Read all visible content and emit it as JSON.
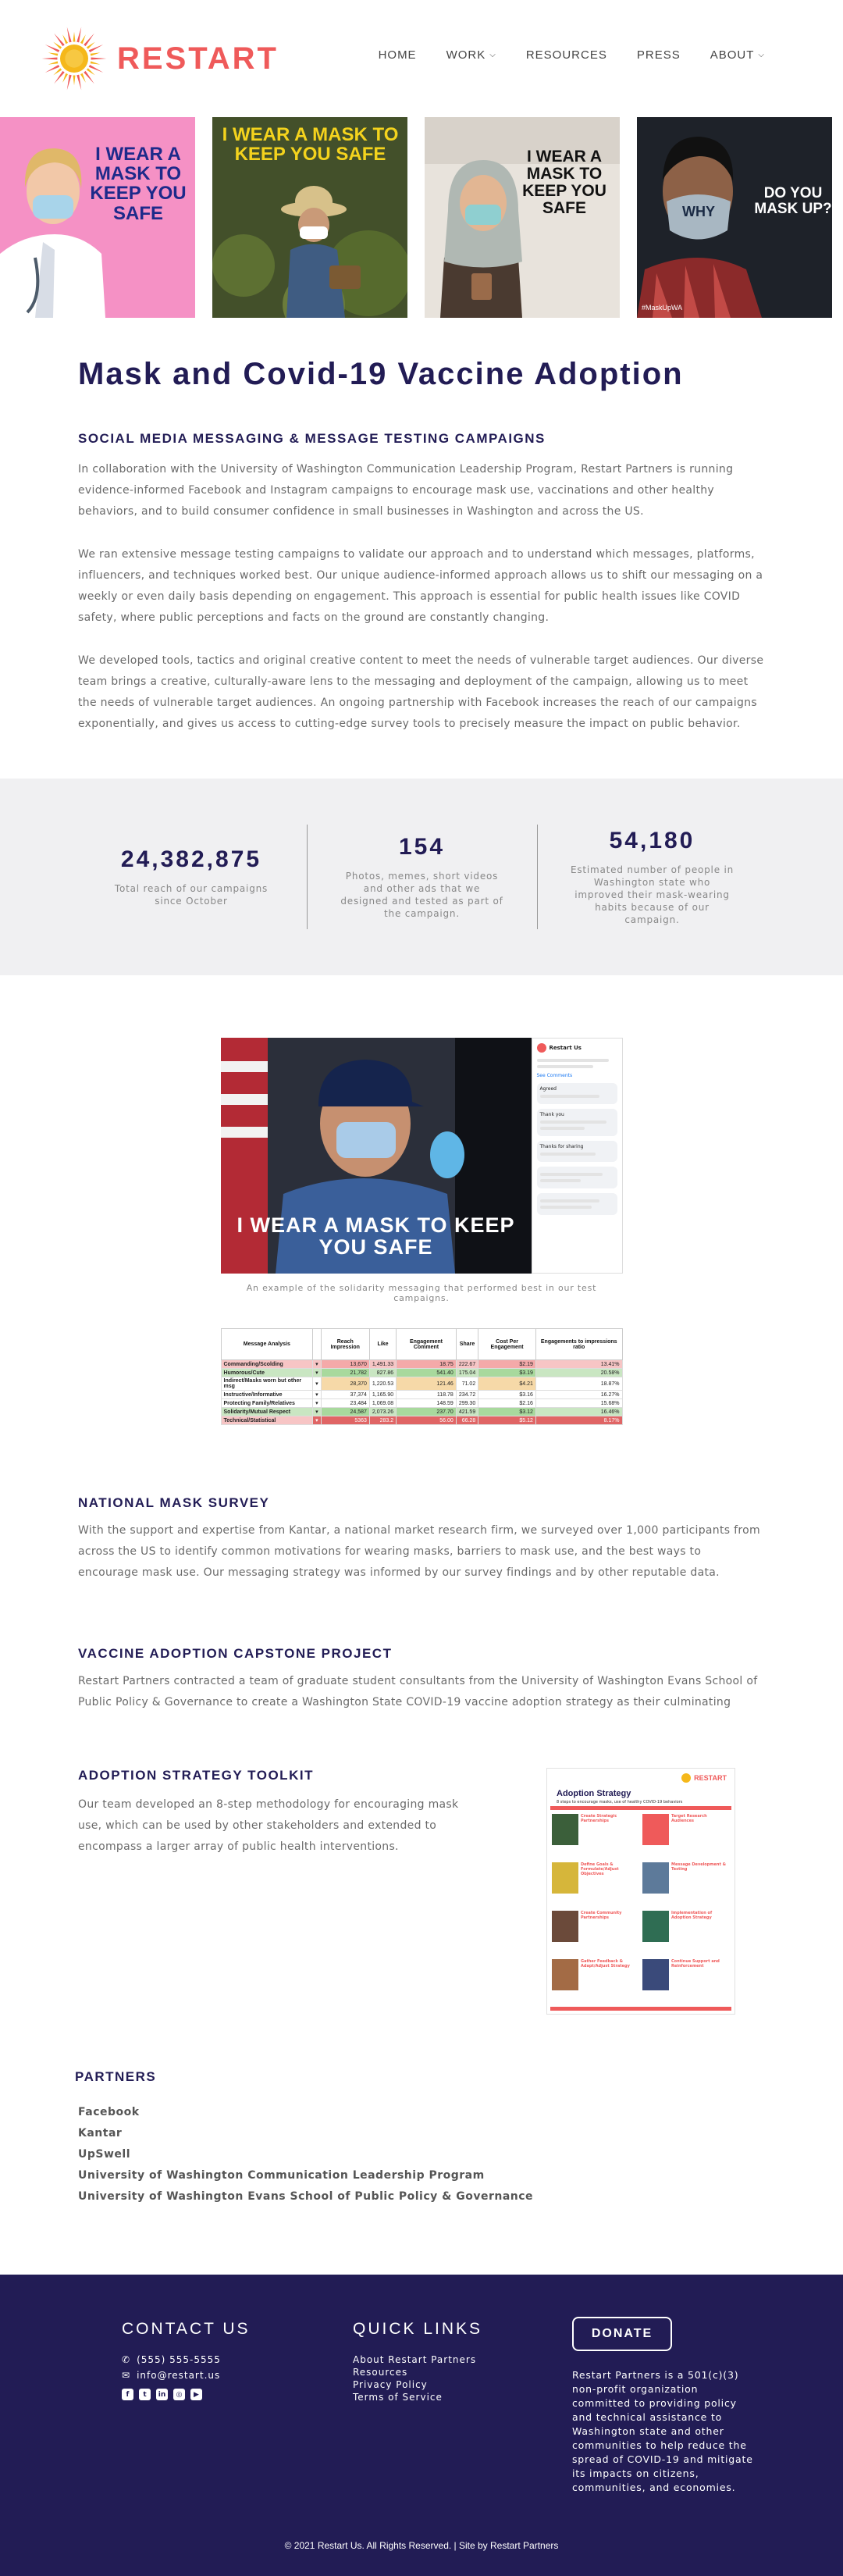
{
  "brand": {
    "name": "RESTART",
    "accent": "#ef5a5a",
    "navy": "#221c55",
    "sun": "#f5b81b"
  },
  "nav": {
    "items": [
      {
        "label": "HOME",
        "has_dropdown": false
      },
      {
        "label": "WORK",
        "has_dropdown": true
      },
      {
        "label": "RESOURCES",
        "has_dropdown": false
      },
      {
        "label": "PRESS",
        "has_dropdown": false
      },
      {
        "label": "ABOUT",
        "has_dropdown": true
      }
    ]
  },
  "hero": {
    "tiles": [
      {
        "caption": "I WEAR A MASK TO KEEP YOU SAFE",
        "bg": "#f591c5"
      },
      {
        "caption": "I WEAR A MASK TO KEEP YOU SAFE",
        "bg": "#43502a"
      },
      {
        "caption": "I WEAR A MASK TO KEEP YOU SAFE",
        "bg": "#e8e3dc"
      },
      {
        "caption": "DO YOU MASK UP?",
        "mask_text": "WHY",
        "tag": "#MaskUpWA",
        "bg": "#1e2229"
      }
    ]
  },
  "page": {
    "title": "Mask and Covid-19 Vaccine Adoption",
    "sections": {
      "social": {
        "heading": "SOCIAL MEDIA MESSAGING & MESSAGE TESTING CAMPAIGNS",
        "p1": "In collaboration with the University of Washington Communication Leadership Program, Restart Partners is running evidence-informed Facebook and Instagram campaigns to encourage mask use, vaccinations and other healthy behaviors, and to build consumer confidence in small businesses in Washington and across the US.",
        "p2": "We ran extensive message testing campaigns to validate our approach and to understand which messages, platforms, influencers, and techniques worked best. Our unique audience-informed approach allows us to shift our messaging on a weekly or even daily basis depending on engagement. This approach is essential for public health issues like COVID safety, where public perceptions and facts on the ground are constantly changing.",
        "p3": "We developed tools, tactics and original creative content to meet the needs of vulnerable target audiences. Our diverse team brings a creative, culturally-aware lens to the messaging and deployment of the campaign, allowing us to meet the needs of vulnerable target audiences.  An ongoing partnership with Facebook increases the reach of our campaigns exponentially, and gives us access to cutting-edge survey tools to precisely measure the impact on public behavior."
      },
      "survey": {
        "heading": "NATIONAL MASK SURVEY",
        "p1": "With the support and expertise from Kantar, a national market research firm, we surveyed over 1,000 participants from across the US to identify common motivations for wearing masks, barriers to mask use, and the best ways to encourage mask use. Our messaging strategy was informed by our survey findings and by other reputable data."
      },
      "vaccine": {
        "heading": "VACCINE ADOPTION CAPSTONE PROJECT",
        "p1": "Restart Partners contracted a team of graduate student consultants from the University of Washington Evans School of Public Policy & Governance to create a Washington State COVID-19 vaccine adoption strategy as their culminating"
      },
      "toolkit": {
        "heading": "ADOPTION STRATEGY TOOLKIT",
        "p1": "Our team developed an 8-step methodology for encouraging mask use, which can be used by other stakeholders and extended to encompass a larger array of public health interventions.",
        "doc_title": "Adoption Strategy",
        "doc_subtitle": "8 steps to encourage masks, use of healthy COVID-19 behaviors",
        "doc_brand": "RESTART",
        "doc_steps": [
          "Create Strategic Partnerships",
          "Target Research Audiences",
          "Define Goals & Formulate/Adjust Objectives",
          "Message Development & Testing",
          "Create Community Partnerships",
          "Implementation of Adoption Strategy",
          "Gather Feedback & Adapt/Adjust Strategy",
          "Continue Support and Reinforcement"
        ]
      }
    }
  },
  "stats": [
    {
      "number": "24,382,875",
      "label": "Total reach of our campaigns since October"
    },
    {
      "number": "154",
      "label": "Photos, memes, short videos and other ads that we designed and tested as part of the campaign."
    },
    {
      "number": "54,180",
      "label": "Estimated number of people in Washington state who improved their mask-wearing habits because of our campaign."
    }
  ],
  "example": {
    "image_caption": "I WEAR A MASK TO KEEP YOU SAFE",
    "caption": "An example of the solidarity messaging that performed best in our test campaigns.",
    "side_page_name": "Restart Us",
    "side_reactions": "See Comments",
    "side_comments": [
      "Agreed",
      "Thank you",
      "Thanks for sharing"
    ]
  },
  "analysis_table": {
    "headers": [
      "Message Analysis",
      "",
      "Reach Impression",
      "Like",
      "Engagement Comment",
      "Share",
      "Cost Per Engagement",
      "Engagements to impressions ratio"
    ],
    "rows": [
      {
        "label": "Commanding/Scolding",
        "cells": [
          "▾",
          "13,670",
          "1,491.33",
          "18.75",
          "222.67",
          "$2.19",
          "13.41%"
        ],
        "tone": "red"
      },
      {
        "label": "Humorous/Cute",
        "cells": [
          "▾",
          "21,782",
          "827.86",
          "541.40",
          "175.04",
          "$3.19",
          "20.58%"
        ],
        "tone": "green"
      },
      {
        "label": "Indirect/Masks worn but other msg",
        "cells": [
          "▾",
          "28,370",
          "1,220.53",
          "121.46",
          "71.02",
          "$4.21",
          "18.87%"
        ],
        "tone": "mixed"
      },
      {
        "label": "Instructive/Informative",
        "cells": [
          "▾",
          "37,374",
          "1,165.90",
          "118.78",
          "234.72",
          "$3.16",
          "16.27%"
        ],
        "tone": "plain"
      },
      {
        "label": "Protecting Family/Relatives",
        "cells": [
          "▾",
          "23,484",
          "1,069.08",
          "148.59",
          "299.30",
          "$2.16",
          "15.68%"
        ],
        "tone": "plain"
      },
      {
        "label": "Solidarity/Mutual Respect",
        "cells": [
          "▾",
          "24,587",
          "2,073.26",
          "237.70",
          "421.59",
          "$3.12",
          "16.46%"
        ],
        "tone": "green"
      },
      {
        "label": "Technical/Statistical",
        "cells": [
          "▾",
          "5363",
          "283.2",
          "56.00",
          "66.28",
          "$5.12",
          "8.17%"
        ],
        "tone": "red"
      }
    ]
  },
  "partners": {
    "heading": "PARTNERS",
    "items": [
      "Facebook",
      "Kantar",
      "UpSwell",
      "University of Washington Communication Leadership Program",
      "University of Washington Evans School of Public Policy & Governance"
    ]
  },
  "footer": {
    "contact_heading": "CONTACT US",
    "phone": "(555) 555-5555",
    "email": "info@restart.us",
    "quick_links_heading": "QUICK LINKS",
    "quick_links": [
      "About Restart Partners",
      "Resources",
      "Privacy Policy",
      "Terms of Service"
    ],
    "donate_label": "DONATE",
    "about": "Restart Partners is a 501(c)(3) non-profit organization committed to providing policy and technical assistance to Washington state and other communities to help reduce the spread of COVID-19 and mitigate its impacts on citizens, communities, and economies.",
    "copyright": "© 2021 Restart Us. All Rights Reserved. | Site by Restart Partners"
  }
}
